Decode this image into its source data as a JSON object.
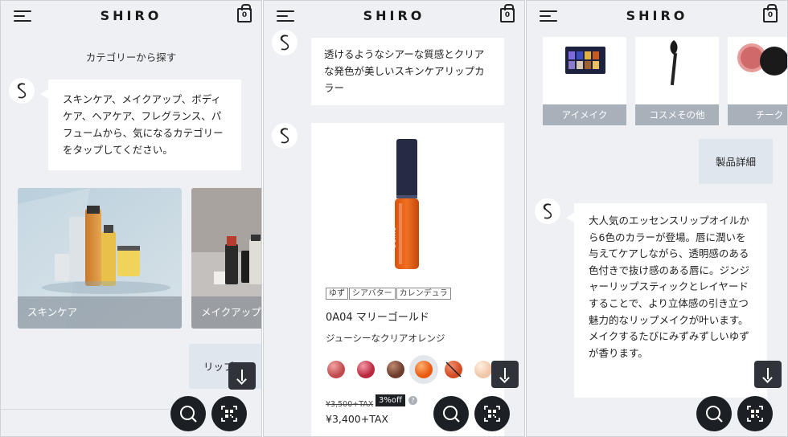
{
  "brand": "SHIRO",
  "cart_count": "0",
  "panel1": {
    "heading": "カテゴリーから探す",
    "bubble_text": "スキンケア、メイクアップ、ボディケア、ヘアケア、フレグランス、パフュームから、気になるカテゴリーをタップしてください。",
    "cards": [
      {
        "label": "スキンケア"
      },
      {
        "label": "メイクアップ"
      }
    ],
    "user_reply": "リップ"
  },
  "panel2": {
    "bubble_text": "透けるようなシアーな質感とクリアな発色が美しいスキンケアリップカラー",
    "product": {
      "tube_brand": "SHIRO",
      "tags": [
        "ゆず",
        "シアバター",
        "カレンデュラ"
      ],
      "name": "0A04 マリーゴールド",
      "subtitle": "ジューシーなクリアオレンジ",
      "old_price": "¥3,500+TAX",
      "discount": "3%off",
      "info": "?",
      "price": "¥3,400+TAX"
    },
    "swatches": [
      "#c04a4e",
      "#b9283e",
      "#6b3b2c",
      "#e85a10",
      "#d24a22",
      "#f2c6a8"
    ]
  },
  "panel3": {
    "categories": [
      {
        "label": "アイメイク"
      },
      {
        "label": "コスメその他"
      },
      {
        "label": "チーク"
      }
    ],
    "user_reply": "製品詳細",
    "bubble_text": "大人気のエッセンスリップオイルから6色のカラーが登場。唇に潤いを与えてケアしながら、透明感のある色付きで抜け感のある唇に。ジンジャーリップスティックとレイヤードすることで、より立体感の引き立つ魅力的なリップメイクが叶います。メイクするたびにみずみずしいゆずが香ります。"
  }
}
